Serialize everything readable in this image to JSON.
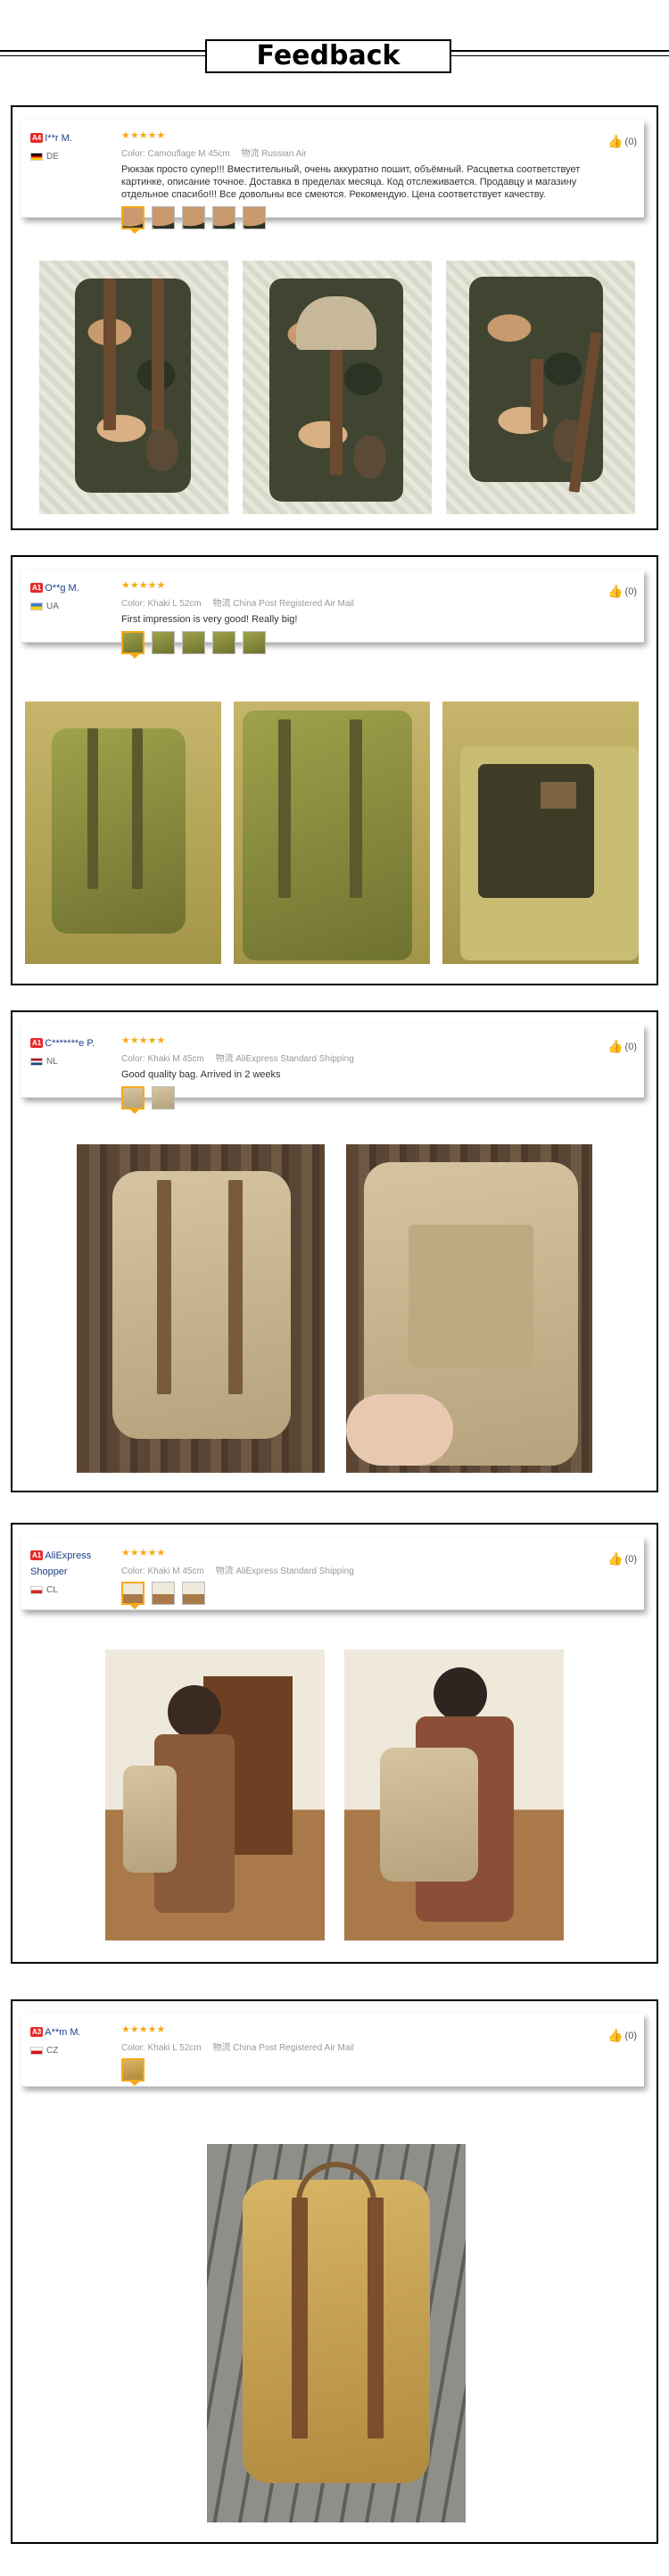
{
  "header": {
    "title": "Feedback"
  },
  "reviews": [
    {
      "badge": "A4",
      "name": "I**r M.",
      "country": "DE",
      "stars": "★★★★★",
      "color_label": "Color:",
      "color_value": "Camouflage M 45cm",
      "ship_label": "物流",
      "ship_value": "Russian Air",
      "text": "Рюкзак просто супер!!! Вместительный, очень аккуратно пошит, объёмный. Расцветка соответствует картинке, описание точное. Доставка в пределах месяца. Код отслеживается. Продавцу и магазину отдельное спасибо!!! Все довольны все смеются. Рекомендую. Цена соответствует качеству.",
      "likes": "(0)",
      "thumb_count": 5
    },
    {
      "badge": "A1",
      "name": "O**g M.",
      "country": "UA",
      "stars": "★★★★★",
      "color_label": "Color:",
      "color_value": "Khaki L 52cm",
      "ship_label": "物流",
      "ship_value": "China Post Registered Air Mail",
      "text": "First impression is very good! Really big!",
      "likes": "(0)",
      "thumb_count": 5
    },
    {
      "badge": "A1",
      "name": "C*******e P.",
      "country": "NL",
      "stars": "★★★★★",
      "color_label": "Color:",
      "color_value": "Khaki M 45cm",
      "ship_label": "物流",
      "ship_value": "AliExpress Standard Shipping",
      "text": "Good quality bag. Arrived in 2 weeks",
      "likes": "(0)",
      "thumb_count": 2
    },
    {
      "badge": "A1",
      "name": "AliExpress Shopper",
      "country": "CL",
      "stars": "★★★★★",
      "color_label": "Color:",
      "color_value": "Khaki M 45cm",
      "ship_label": "物流",
      "ship_value": "AliExpress Standard Shipping",
      "text": "",
      "likes": "(0)",
      "thumb_count": 3
    },
    {
      "badge": "A3",
      "name": "A**m M.",
      "country": "CZ",
      "stars": "★★★★★",
      "color_label": "Color:",
      "color_value": "Khaki L 52cm",
      "ship_label": "物流",
      "ship_value": "China Post Registered Air Mail",
      "text": "",
      "likes": "(0)",
      "thumb_count": 1
    }
  ],
  "colors": {
    "star": "#f7a81b",
    "badge": "#e52b2b",
    "username": "#1a3e8c",
    "border": "#000000"
  },
  "icons": {
    "like": "thumbs-up-icon",
    "star": "star-icon"
  }
}
